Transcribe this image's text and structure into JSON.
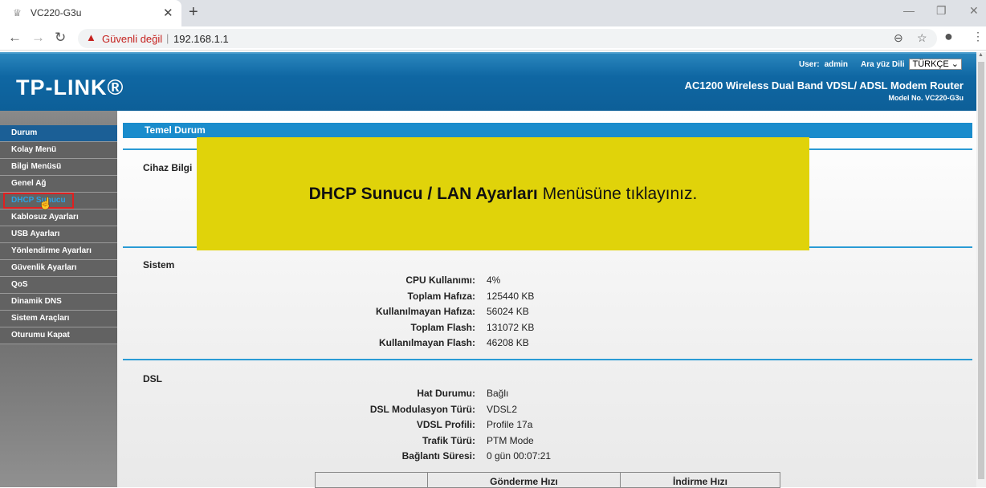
{
  "browser": {
    "tab_title": "VC220-G3u",
    "security": "Güvenli değil",
    "url": "192.168.1.1"
  },
  "header": {
    "logo": "TP-LINK®",
    "user_label": "User:",
    "user": "admin",
    "lang_label": "Ara yüz Dili",
    "lang": "TÜRKÇE",
    "product": "AC1200 Wireless Dual Band VDSL/ ADSL Modem Router",
    "model": "Model No. VC220-G3u"
  },
  "menu": [
    "Durum",
    "Kolay Menü",
    "Bilgi Menüsü",
    "Genel Ağ",
    "DHCP Sunucu",
    "Kablosuz Ayarları",
    "USB Ayarları",
    "Yönlendirme Ayarları",
    "Güvenlik Ayarları",
    "QoS",
    "Dinamik DNS",
    "Sistem Araçları",
    "Oturumu Kapat"
  ],
  "main": {
    "title": "Temel Durum",
    "section_device": "Cihaz Bilgi",
    "section_system": "Sistem",
    "section_dsl": "DSL",
    "system": [
      {
        "k": "CPU Kullanımı:",
        "v": "4%"
      },
      {
        "k": "Toplam Hafıza:",
        "v": "125440 KB"
      },
      {
        "k": "Kullanılmayan Hafıza:",
        "v": "56024 KB"
      },
      {
        "k": "Toplam Flash:",
        "v": "131072 KB"
      },
      {
        "k": "Kullanılmayan Flash:",
        "v": "46208 KB"
      }
    ],
    "dsl": [
      {
        "k": "Hat Durumu:",
        "v": "Bağlı"
      },
      {
        "k": "DSL Modulasyon Türü:",
        "v": "VDSL2"
      },
      {
        "k": "VDSL Profili:",
        "v": "Profile 17a"
      },
      {
        "k": "Trafik Türü:",
        "v": "PTM Mode"
      },
      {
        "k": "Bağlantı Süresi:",
        "v": "0 gün 00:07:21"
      }
    ],
    "table_headers": [
      "",
      "Gönderme Hızı",
      "İndirme Hızı"
    ]
  },
  "overlay": {
    "bold": "DHCP Sunucu / LAN Ayarları",
    "rest": "Menüsüne tıklayınız."
  }
}
